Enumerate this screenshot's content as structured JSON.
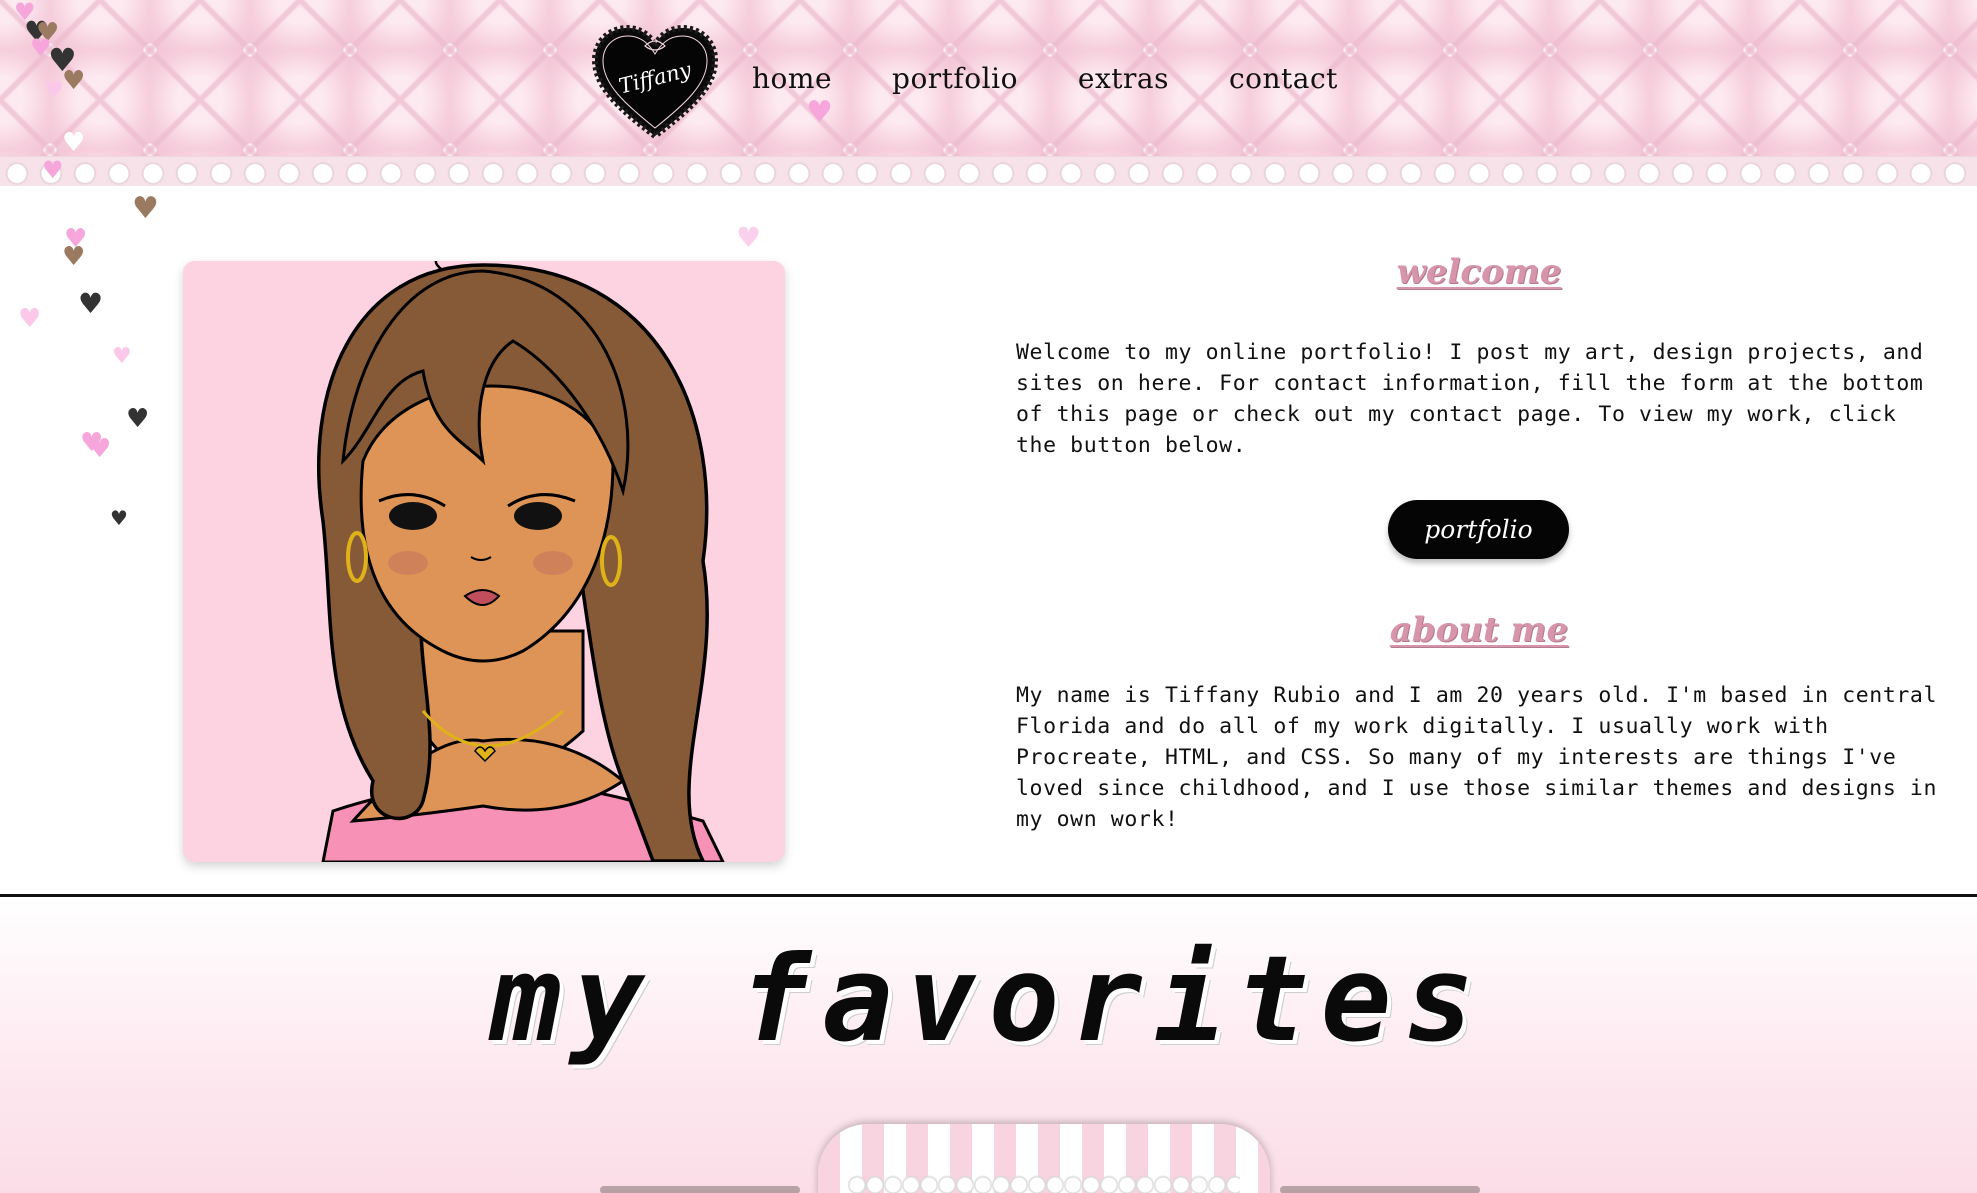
{
  "header": {
    "logo_text": "Tiffany",
    "nav": [
      {
        "label": "home"
      },
      {
        "label": "portfolio"
      },
      {
        "label": "extras"
      },
      {
        "label": "contact"
      }
    ]
  },
  "welcome": {
    "title": "welcome",
    "text": "Welcome to my online portfolio! I post my art, design projects, and sites on here. For contact information, fill the form at the bottom of this page or check out my contact page. To view my work, click the button below.",
    "button_label": "portfolio"
  },
  "about": {
    "title": "about me",
    "text": "My name is Tiffany Rubio and I am 20 years old. I'm based in central Florida and do all of my work digitally. I usually work with Procreate, HTML, and CSS. So many of my interests are things I've loved since childhood, and I use those similar themes and designs in my own work!"
  },
  "favorites": {
    "title": "my favorites"
  },
  "colors": {
    "accent_pink": "#d795ab",
    "header_pink": "#fbe6ee",
    "card_pink": "#fdd3e1",
    "button_black": "#050505"
  },
  "icons": [
    "heart-logo-icon",
    "heart-icon"
  ]
}
